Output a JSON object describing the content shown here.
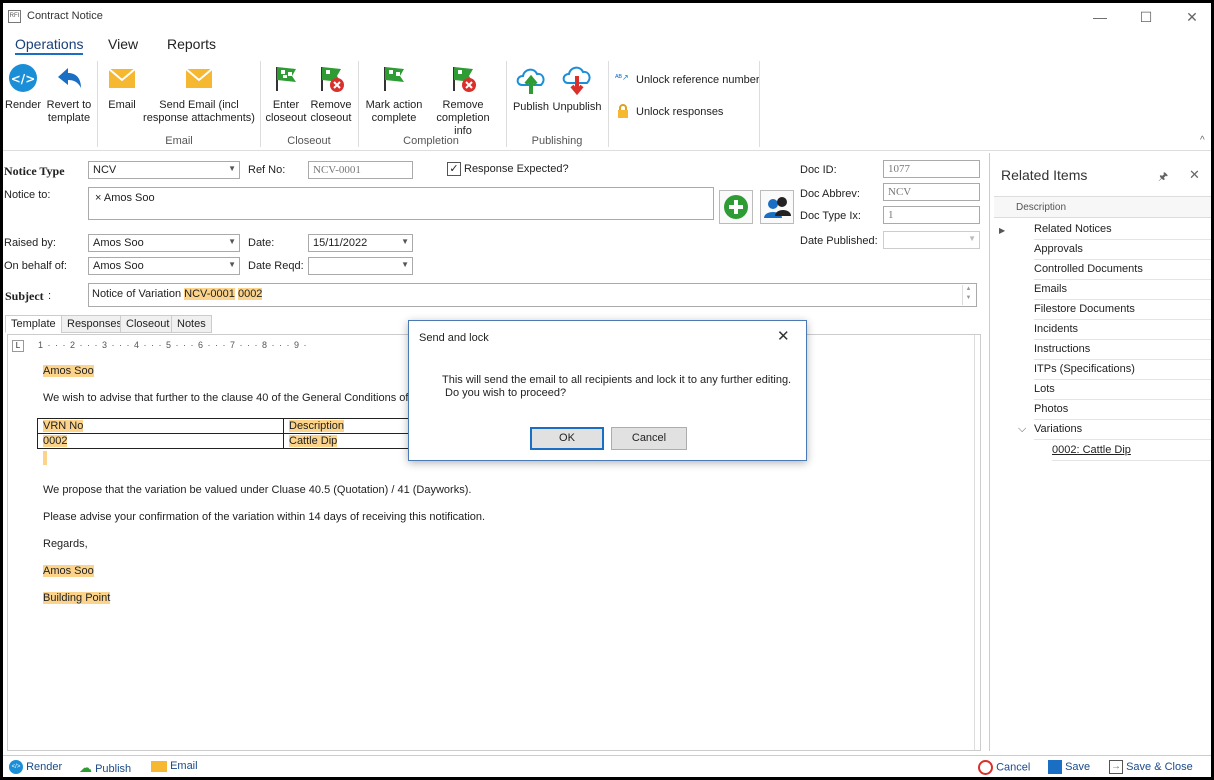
{
  "window": {
    "title": "Contract Notice",
    "minimize": "—",
    "maximize": "☐",
    "close": "✕"
  },
  "menu": {
    "operations": "Operations",
    "view": "View",
    "reports": "Reports"
  },
  "ribbon": {
    "render": "Render",
    "revert_1": "Revert to",
    "revert_2": "template",
    "email": "Email",
    "send_email_1": "Send Email (incl",
    "send_email_2": "response attachments)",
    "email_group": "Email",
    "enter_closeout_1": "Enter",
    "enter_closeout_2": "closeout",
    "remove_closeout_1": "Remove",
    "remove_closeout_2": "closeout",
    "closeout_group": "Closeout",
    "mark_action_1": "Mark action",
    "mark_action_2": "complete",
    "remove_completion_1": "Remove",
    "remove_completion_2": "completion info",
    "completion_group": "Completion",
    "publish": "Publish",
    "unpublish": "Unpublish",
    "publishing_group": "Publishing",
    "unlock_ref": "Unlock reference number",
    "unlock_responses": "Unlock responses"
  },
  "form": {
    "notice_type_label": "Notice Type",
    "notice_type": "NCV",
    "ref_no_label": "Ref No:",
    "ref_no": "NCV-0001",
    "response_expected": "Response Expected?",
    "notice_to_label": "Notice to:",
    "notice_to_token": "× Amos Soo",
    "raised_by_label": "Raised by:",
    "raised_by": "Amos Soo",
    "date_label": "Date:",
    "date": "15/11/2022",
    "on_behalf_label": "On behalf of:",
    "on_behalf": "Amos Soo",
    "date_reqd_label": "Date Reqd:",
    "date_reqd": "",
    "subject_label": "Subject",
    "subject_prefix": "Notice of Variation ",
    "subject_ref": "NCV-0001",
    "subject_num": "0002",
    "doc_id_label": "Doc ID:",
    "doc_id": "1077",
    "doc_abbrev_label": "Doc Abbrev:",
    "doc_abbrev": "NCV",
    "doc_type_label": "Doc Type Ix:",
    "doc_type": "1",
    "date_published_label": "Date Published:",
    "date_published": ""
  },
  "tabs": [
    "Template",
    "Responses",
    "Closeout",
    "Notes"
  ],
  "ruler": "1 · · · 2 · · · 3 · · · 4 · · · 5 · · · 6 · · · 7 · · · 8 · · · 9 ·",
  "document": {
    "addressee": "Amos Soo",
    "line1": "We wish to advise that further to the clause 40 of the General Conditions of the C",
    "table_headers": [
      "VRN No",
      "Description"
    ],
    "table_row": [
      "0002",
      "Cattle Dip"
    ],
    "line2": "We propose that the variation be valued under Cluase 40.5 (Quotation) / 41 (Dayworks).",
    "line3": "Please advise your confirmation of the variation within 14 days of receiving this notification.",
    "regards": "Regards,",
    "sign_name": "Amos Soo",
    "sign_company": "Building Point"
  },
  "related": {
    "title": "Related Items",
    "pin": "🖈",
    "close": "✕",
    "column": "Description",
    "items": [
      "Related Notices",
      "Approvals",
      "Controlled Documents",
      "Emails",
      "Filestore Documents",
      "Incidents",
      "Instructions",
      "ITPs (Specifications)",
      "Lots",
      "Photos",
      "Variations"
    ],
    "child": "0002: Cattle Dip"
  },
  "dialog": {
    "title": "Send and lock",
    "close": "✕",
    "message1": "This will send the email to all recipients and lock it to any further editing.",
    "message2": "Do you wish to proceed?",
    "ok": "OK",
    "cancel": "Cancel"
  },
  "status": {
    "render": "Render",
    "publish": "Publish",
    "email": "Email",
    "cancel": "Cancel",
    "save": "Save",
    "save_close": "Save & Close"
  },
  "colors": {
    "accent": "#1a6fc4",
    "highlight": "#fbd38a",
    "flag_green": "#2e9b35",
    "danger": "#d9302c",
    "email_yellow": "#f5b830"
  }
}
